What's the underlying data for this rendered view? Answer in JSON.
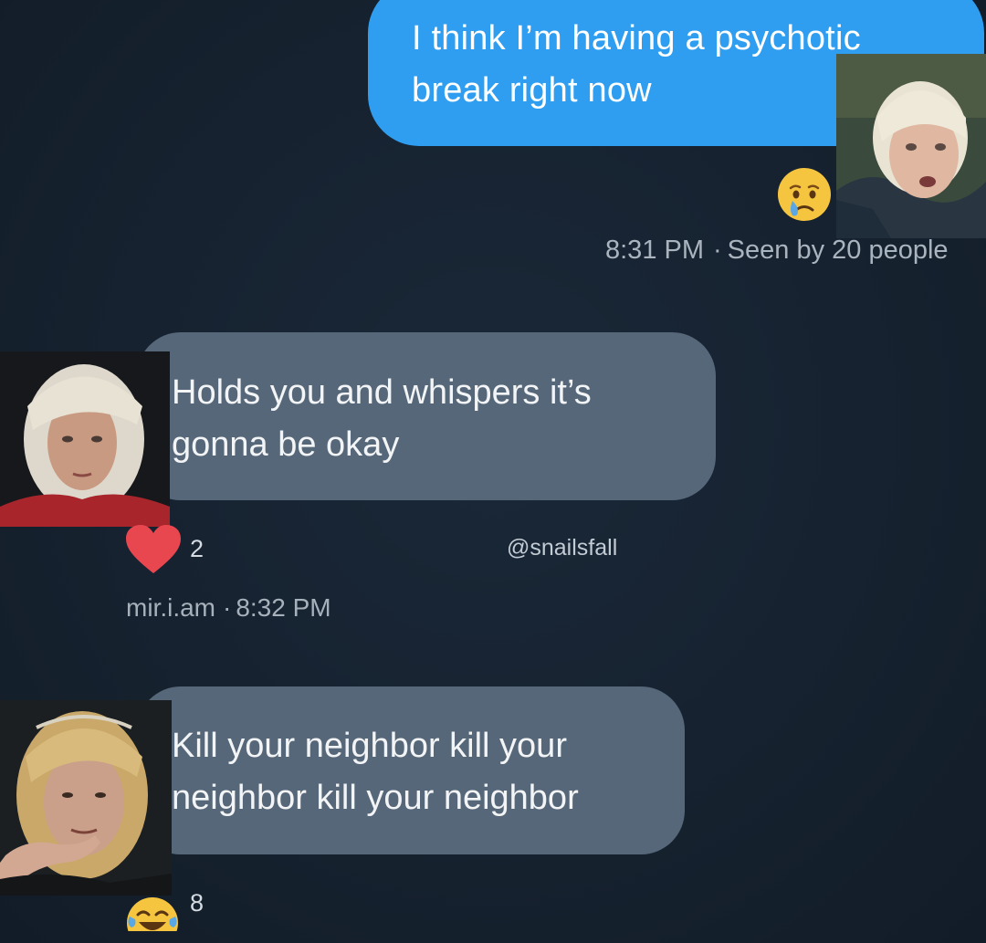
{
  "thread": {
    "outgoing": {
      "lines": [
        "I think I’m having a psychotic",
        "break right now"
      ],
      "reaction_icon": "crying-face-emoji",
      "time": "8:31 PM",
      "seen": "Seen by 20 people",
      "separator": "·"
    },
    "incoming_1": {
      "lines": [
        "Holds you and whispers it’s",
        "gonna be okay"
      ],
      "reaction_icon": "heart-icon",
      "reaction_count": "2",
      "sender": "mir.i.am",
      "time": "8:32 PM",
      "separator": "·"
    },
    "incoming_2": {
      "lines": [
        "Kill your neighbor kill your",
        "neighbor kill your neighbor"
      ],
      "reaction_icon": "tears-of-joy-emoji",
      "reaction_count": "8"
    },
    "watermark": "@snailsfall"
  },
  "colors": {
    "background": "#162231",
    "outgoing_bubble": "#2f9ef0",
    "incoming_bubble": "#566779",
    "heart": "#e8474f",
    "meta_text": "#aab4bf"
  }
}
